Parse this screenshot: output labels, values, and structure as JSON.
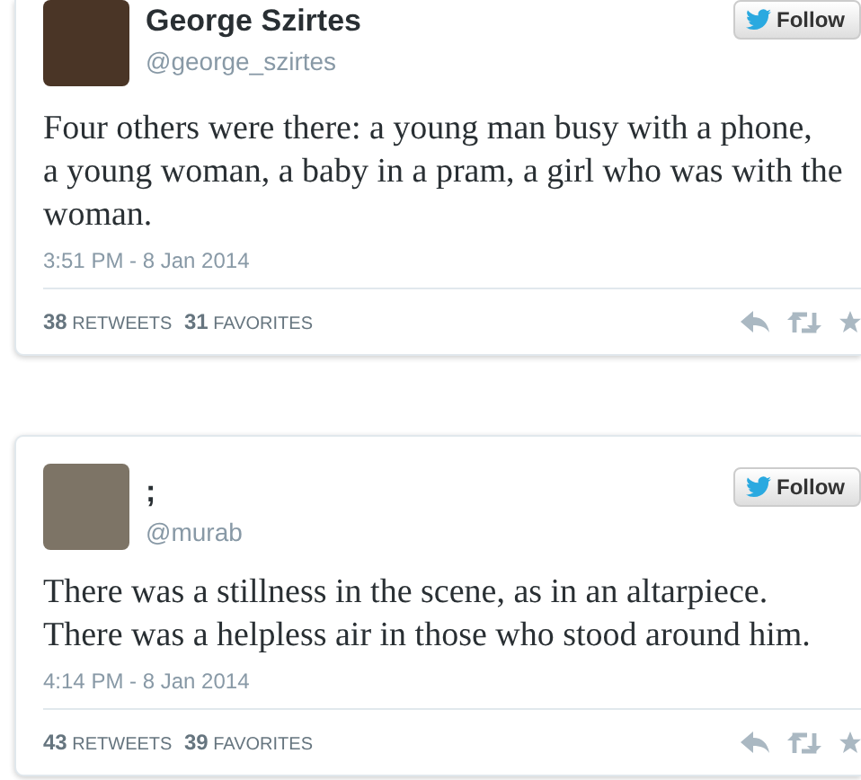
{
  "tweets": [
    {
      "name": "George Szirtes",
      "handle": "@george_szirtes",
      "follow": "Follow",
      "text_lines": [
        "Four others were there: a young man busy with a phone,",
        "a young woman, a baby in a pram, a girl who was with the",
        "woman."
      ],
      "time": "3:51 PM - 8 Jan 2014",
      "retweets": "38",
      "retweets_label": "RETWEETS",
      "favorites": "31",
      "favorites_label": "FAVORITES"
    },
    {
      "name": ";",
      "handle": "@murab",
      "follow": "Follow",
      "text_lines": [
        "There was a stillness in the scene, as in an altarpiece.",
        "There was a helpless air in those who stood around him."
      ],
      "time": "4:14 PM - 8 Jan 2014",
      "retweets": "43",
      "retweets_label": "RETWEETS",
      "favorites": "39",
      "favorites_label": "FAVORITES"
    }
  ]
}
